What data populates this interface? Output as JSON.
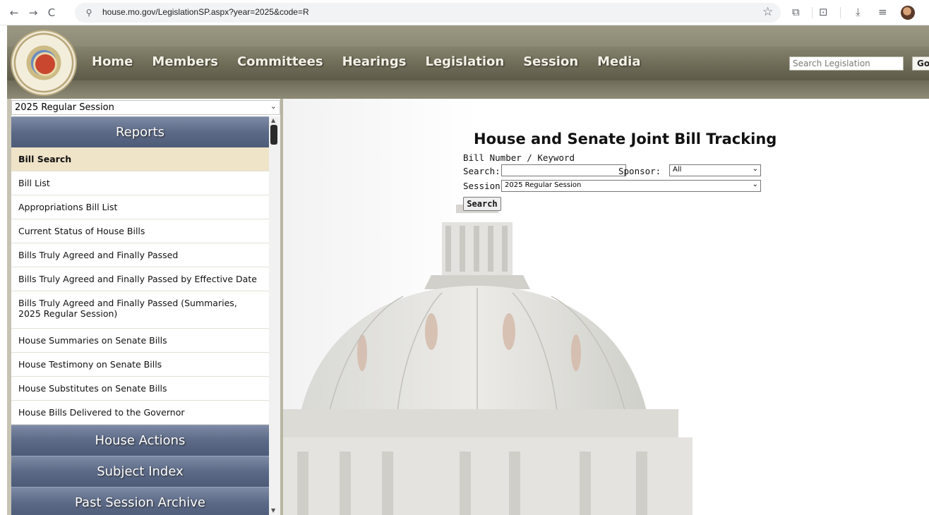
{
  "browser": {
    "url": "house.mo.gov/LegislationSP.aspx?year=2025&code=R",
    "back_icon": "←",
    "forward_icon": "→",
    "reload_icon": "C",
    "site_info_icon": "⚲",
    "bookmark_icon": "☆",
    "extensions_icon": "⧉",
    "tab_search_icon": "⊡",
    "download_icon": "⤓",
    "reading_list_icon": "≡"
  },
  "header": {
    "seal_text": "MISSOURI HOUSE OF REPRESENTATIVES",
    "nav": [
      "Home",
      "Members",
      "Committees",
      "Hearings",
      "Legislation",
      "Session",
      "Media"
    ],
    "search_placeholder": "Search Legislation",
    "go_label": "Go"
  },
  "sidebar": {
    "session_select": "2025 Regular Session",
    "reports_header": "Reports",
    "reports_items": [
      "Bill Search",
      "Bill List",
      "Appropriations Bill List",
      "Current Status of House Bills",
      "Bills Truly Agreed and Finally Passed",
      "Bills Truly Agreed and Finally Passed by Effective Date",
      "Bills Truly Agreed and Finally Passed (Summaries, 2025 Regular Session)",
      "House Summaries on Senate Bills",
      "House Testimony on Senate Bills",
      "House Substitutes on Senate Bills",
      "House Bills Delivered to the Governor"
    ],
    "house_actions_header": "House Actions",
    "subject_index_header": "Subject Index",
    "past_session_header": "Past Session Archive"
  },
  "main": {
    "title": "House and Senate Joint Bill Tracking",
    "subtitle": "Bill Number / Keyword",
    "search_label": "Search:",
    "search_value": "",
    "sponsor_label": "Sponsor:",
    "sponsor_value": "All",
    "session_label": "Session:",
    "session_value": "2025 Regular Session",
    "search_button": "Search"
  },
  "colors": {
    "header_bg": "#7a7763",
    "section_header": "#5c6a87",
    "active_item": "#efe3c8"
  }
}
